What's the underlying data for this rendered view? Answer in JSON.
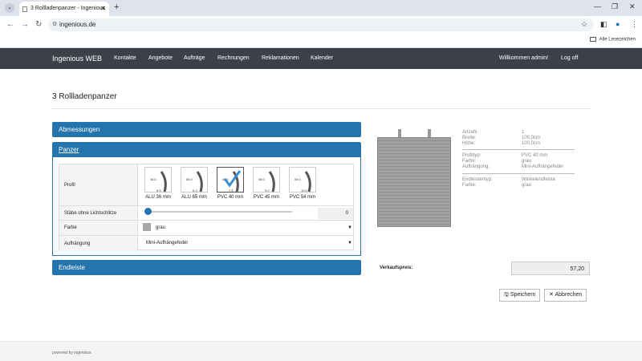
{
  "browser": {
    "tab_title": "3 Rollladenpanzer - Ingenious",
    "url": "ingenious.de",
    "bookmarks": "Alle Lesezeichen"
  },
  "nav": {
    "brand": "Ingenious WEB",
    "items": [
      "Kontakte",
      "Angebote",
      "Aufträge",
      "Rechnungen",
      "Reklamationen",
      "Kalender"
    ],
    "welcome": "Willkommen admin!",
    "logoff": "Log off"
  },
  "page": {
    "title": "3 Rollladenpanzer"
  },
  "sections": {
    "abmessungen": "Abmessungen",
    "panzer": "Panzer",
    "endleiste": "Endleiste"
  },
  "form": {
    "profil_label": "Profil",
    "profiles": [
      {
        "name": "ALU 36 mm",
        "h": "36.0",
        "w": "8.5"
      },
      {
        "name": "ALU 65 mm",
        "h": "65.0",
        "w": "6.3"
      },
      {
        "name": "PVC 40 mm",
        "h": "40.0",
        "w": "7.5"
      },
      {
        "name": "PVC 45 mm",
        "h": "45.0",
        "w": "9.0"
      },
      {
        "name": "PVC 54 mm",
        "h": "54.0",
        "w": "10.0"
      }
    ],
    "selected_profile": "PVC 40 mm",
    "staebe_label": "Stäbe ohne Lichtschlitze",
    "staebe_value": "0",
    "farbe_label": "Farbe",
    "farbe_value": "grau",
    "farbe_color": "#a9a9a9",
    "aufhaengung_label": "Aufhängung",
    "aufhaengung_value": "Mini-Aufhängefeder"
  },
  "specs": {
    "anzahl_k": "Anzahl:",
    "anzahl_v": "1",
    "breite_k": "Breite:",
    "breite_v": "100,0cm",
    "hoehe_k": "Höhe:",
    "hoehe_v": "100,0cm",
    "profiltyp_k": "Profiltyp:",
    "profiltyp_v": "PVC 40 mm",
    "farbe_k": "Farbe:",
    "farbe_v": "grau",
    "aufh_k": "Aufhängung:",
    "aufh_v": "Mini-Aufhängefeder",
    "endleistentyp_k": "Endleistentyp:",
    "endleistentyp_v": "Winkelendleiste",
    "efarbe_k": "Farbe:",
    "efarbe_v": "grau"
  },
  "price": {
    "label": "Verkaufspreis:",
    "value": "57,20"
  },
  "buttons": {
    "save": "Speichern",
    "cancel": "Abbrechen"
  },
  "footer": "powered by ingenious"
}
